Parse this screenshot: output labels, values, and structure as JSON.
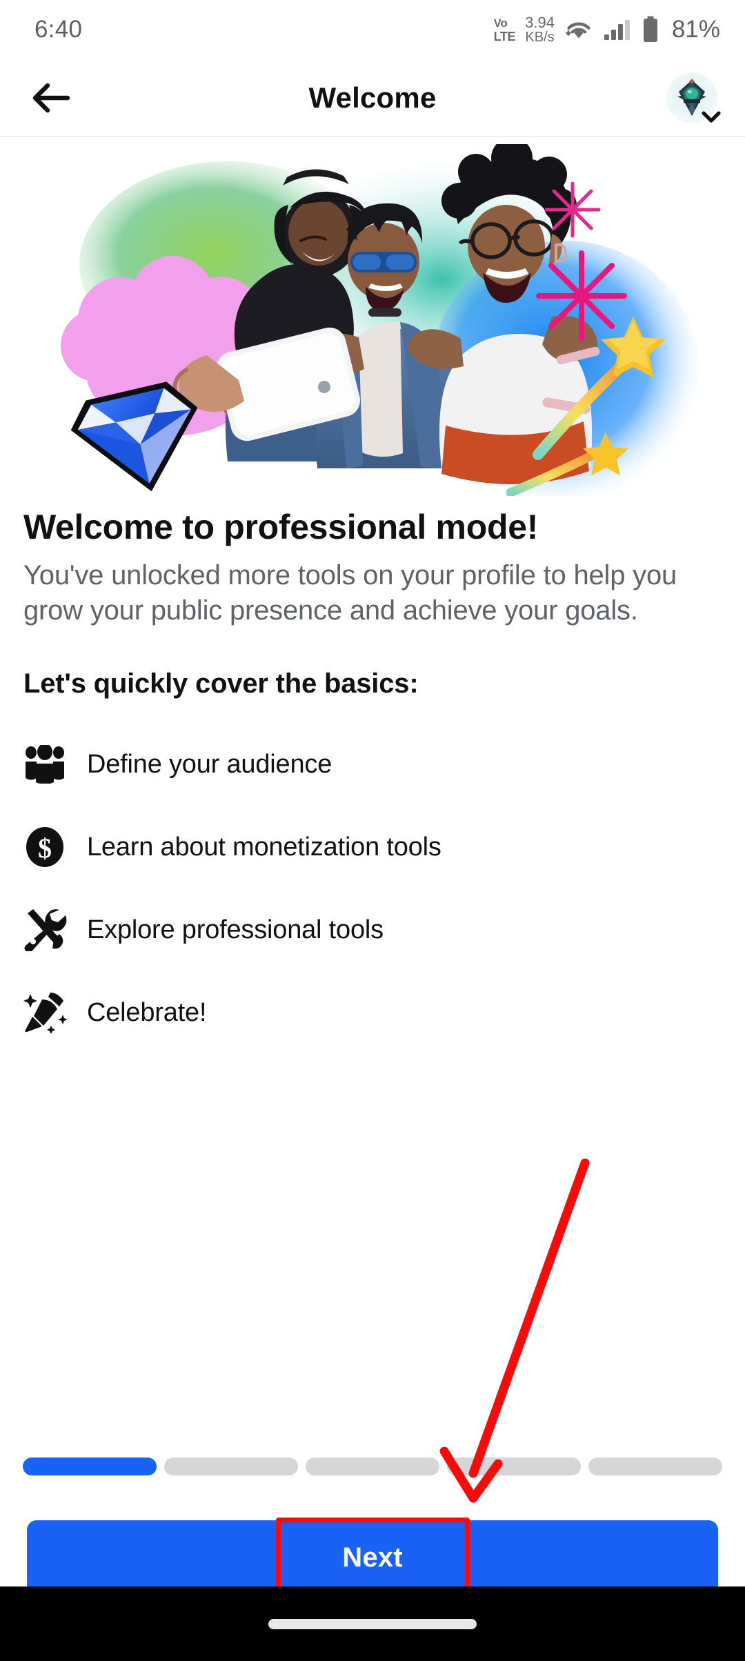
{
  "status_bar": {
    "time": "6:40",
    "volte_line1": "Vo",
    "volte_line2": "LTE",
    "network_speed_value": "3.94",
    "network_speed_unit": "KB/s",
    "wifi_icon": "wifi-icon",
    "signal_icon": "cellular-signal-icon",
    "battery_icon": "battery-icon",
    "battery_percent": "81%"
  },
  "header": {
    "back_icon": "back-arrow-icon",
    "title": "Welcome",
    "avatar_icon": "user-avatar",
    "chevron_icon": "chevron-down-icon"
  },
  "hero": {
    "alt": "three-friends-taking-selfie-illustration",
    "decor": {
      "diamond": "blue-diamond-gem",
      "pink_blob": "pink-cloud-blob",
      "green_blob": "green-gradient-blob",
      "blue_blob": "blue-gradient-blob",
      "sparkle_1": "pink-starburst",
      "sparkle_2": "pink-starburst",
      "shooting_star_1": "yellow-shooting-star",
      "shooting_star_2": "yellow-shooting-star"
    },
    "colors": {
      "green": "#7dc242",
      "teal": "#2ab9a6",
      "blue": "#1b7ef0",
      "pink": "#f09ae8",
      "magenta": "#e6187d",
      "yellow": "#f7c22b",
      "gem_blue": "#1a5ce0"
    }
  },
  "main": {
    "title": "Welcome to professional mode!",
    "subtitle": "You've unlocked more tools on your profile to help you grow your public presence and achieve your goals.",
    "basics_heading": "Let's quickly cover the basics:",
    "basics": [
      {
        "icon": "people-group-icon",
        "label": "Define your audience"
      },
      {
        "icon": "dollar-circle-icon",
        "label": "Learn about monetization tools"
      },
      {
        "icon": "tools-wrench-screwdriver-icon",
        "label": "Explore professional tools"
      },
      {
        "icon": "party-popper-icon",
        "label": "Celebrate!"
      }
    ]
  },
  "progress": {
    "total_steps": 5,
    "current_step": 1,
    "active_color": "#1a62f5",
    "inactive_color": "#d4d6d8"
  },
  "footer": {
    "next_label": "Next",
    "button_color": "#1a62f5"
  },
  "annotations": {
    "highlight_color": "#fb0a0a",
    "highlight_target": "next-button",
    "arrow_target": "next-button"
  },
  "nav_bar": {
    "home_indicator": "home-indicator-pill"
  }
}
